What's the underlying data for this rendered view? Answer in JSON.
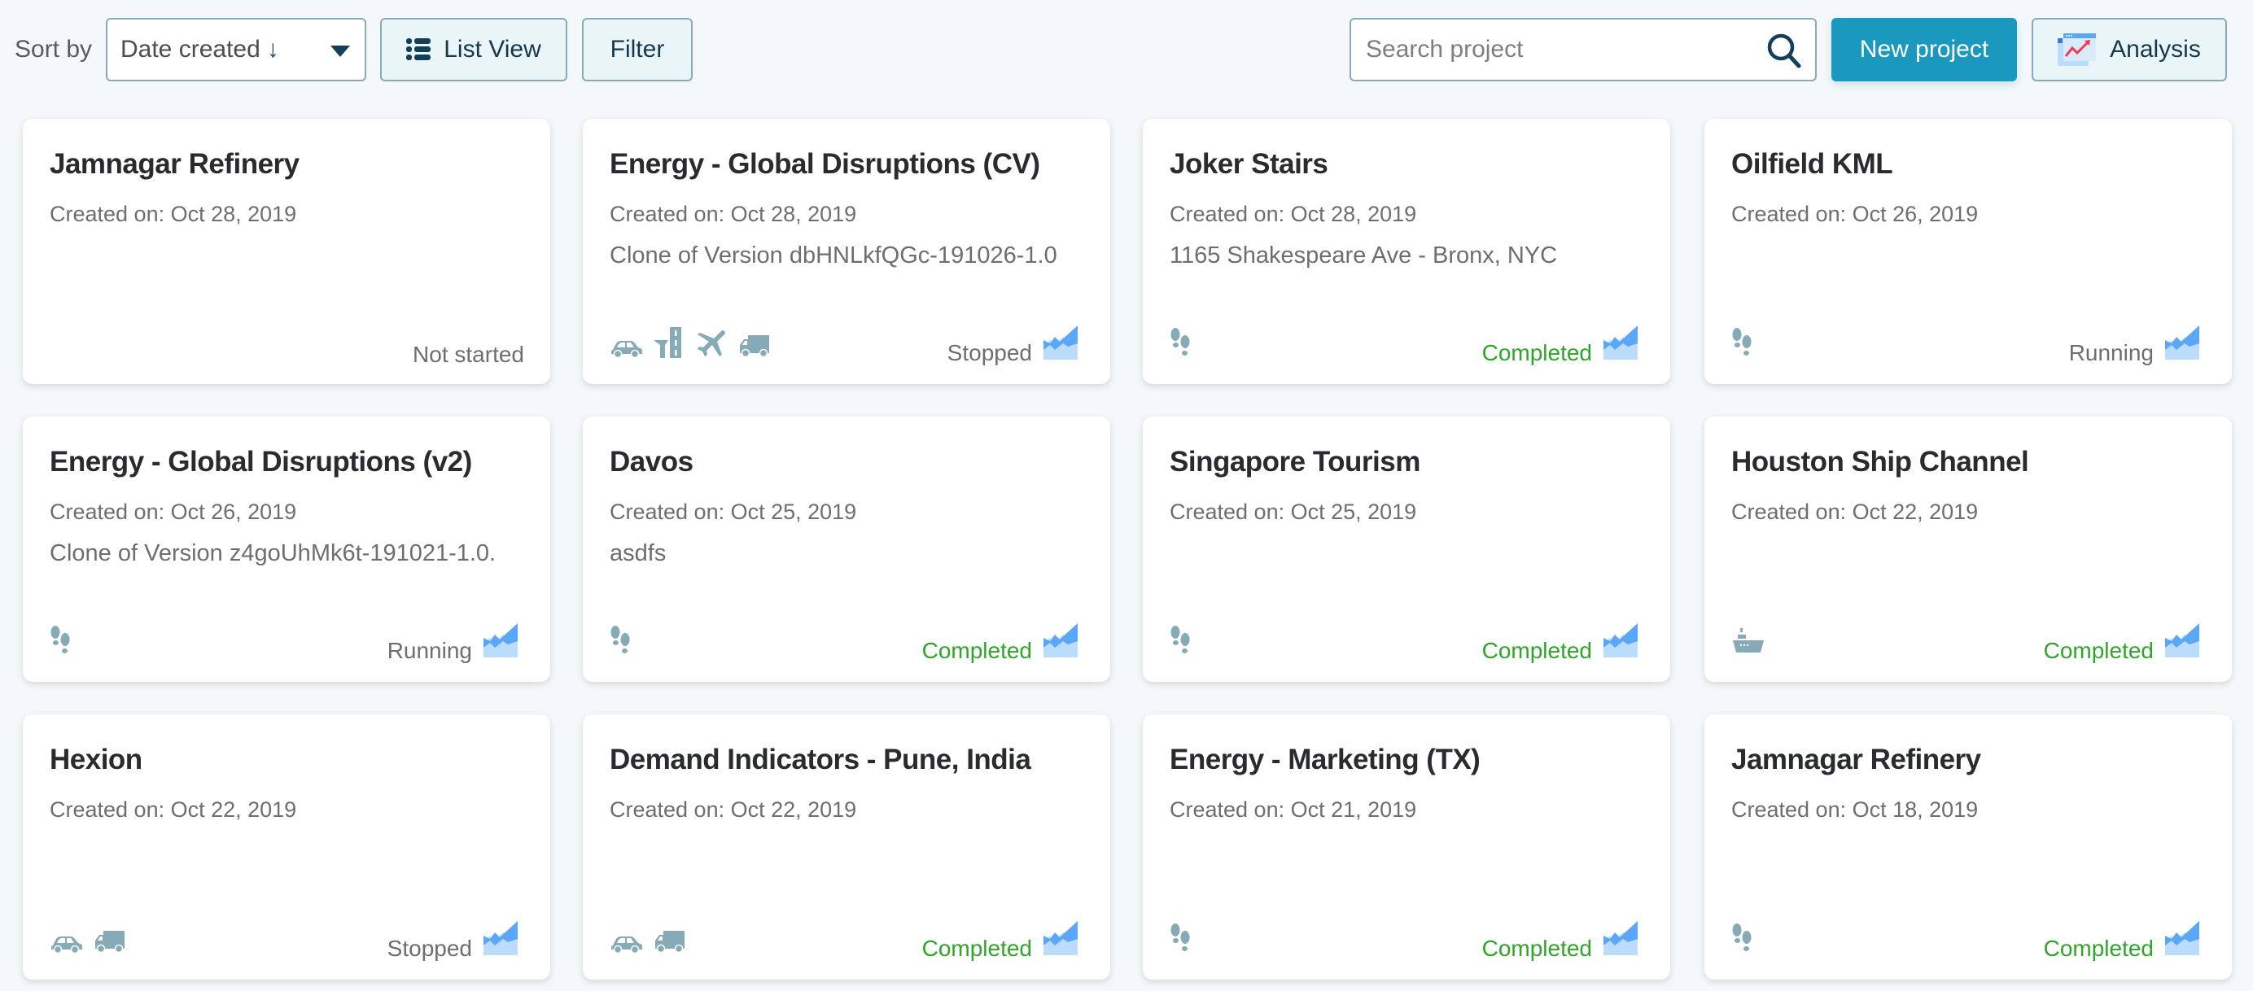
{
  "toolbar": {
    "sort_label": "Sort by",
    "sort_value": "Date created",
    "sort_direction": "↓",
    "list_view_label": "List View",
    "filter_label": "Filter",
    "search_placeholder": "Search project",
    "search_value": "",
    "new_project_label": "New project",
    "analysis_label": "Analysis"
  },
  "colors": {
    "accent": "#1a98bd",
    "completed": "#2fa52a",
    "icon": "#86abb6",
    "chart_dark": "#5aa6f7",
    "chart_light": "#bcdcfc"
  },
  "projects": [
    {
      "title": "Jamnagar Refinery",
      "created": "Created on: Oct 28, 2019",
      "description": "",
      "icons": [],
      "status": "Not started",
      "show_chart_icon": false
    },
    {
      "title": "Energy - Global Disruptions (CV)",
      "created": "Created on: Oct 28, 2019",
      "description": "Clone of Version dbHNLkfQGc-191026-1.0",
      "icons": [
        "car-icon",
        "road-icon",
        "plane-icon",
        "truck-icon"
      ],
      "status": "Stopped",
      "show_chart_icon": true
    },
    {
      "title": "Joker Stairs",
      "created": "Created on: Oct 28, 2019",
      "description": "1165 Shakespeare Ave - Bronx, NYC",
      "icons": [
        "footprints-icon"
      ],
      "status": "Completed",
      "show_chart_icon": true
    },
    {
      "title": "Oilfield KML",
      "created": "Created on: Oct 26, 2019",
      "description": "",
      "icons": [
        "footprints-icon"
      ],
      "status": "Running",
      "show_chart_icon": true
    },
    {
      "title": "Energy - Global Disruptions (v2)",
      "created": "Created on: Oct 26, 2019",
      "description": "Clone of Version z4goUhMk6t-191021-1.0.",
      "icons": [
        "footprints-icon"
      ],
      "status": "Running",
      "show_chart_icon": true
    },
    {
      "title": "Davos",
      "created": "Created on: Oct 25, 2019",
      "description": "asdfs",
      "icons": [
        "footprints-icon"
      ],
      "status": "Completed",
      "show_chart_icon": true
    },
    {
      "title": "Singapore Tourism",
      "created": "Created on: Oct 25, 2019",
      "description": "",
      "icons": [
        "footprints-icon"
      ],
      "status": "Completed",
      "show_chart_icon": true
    },
    {
      "title": "Houston Ship Channel",
      "created": "Created on: Oct 22, 2019",
      "description": "",
      "icons": [
        "ship-icon"
      ],
      "status": "Completed",
      "show_chart_icon": true
    },
    {
      "title": "Hexion",
      "created": "Created on: Oct 22, 2019",
      "description": "",
      "icons": [
        "car-icon",
        "truck-icon"
      ],
      "status": "Stopped",
      "show_chart_icon": true
    },
    {
      "title": "Demand Indicators - Pune, India",
      "created": "Created on: Oct 22, 2019",
      "description": "",
      "icons": [
        "car-icon",
        "truck-icon"
      ],
      "status": "Completed",
      "show_chart_icon": true
    },
    {
      "title": "Energy - Marketing (TX)",
      "created": "Created on: Oct 21, 2019",
      "description": "",
      "icons": [
        "footprints-icon"
      ],
      "status": "Completed",
      "show_chart_icon": true
    },
    {
      "title": "Jamnagar Refinery",
      "created": "Created on: Oct 18, 2019",
      "description": "",
      "icons": [
        "footprints-icon"
      ],
      "status": "Completed",
      "show_chart_icon": true
    }
  ]
}
